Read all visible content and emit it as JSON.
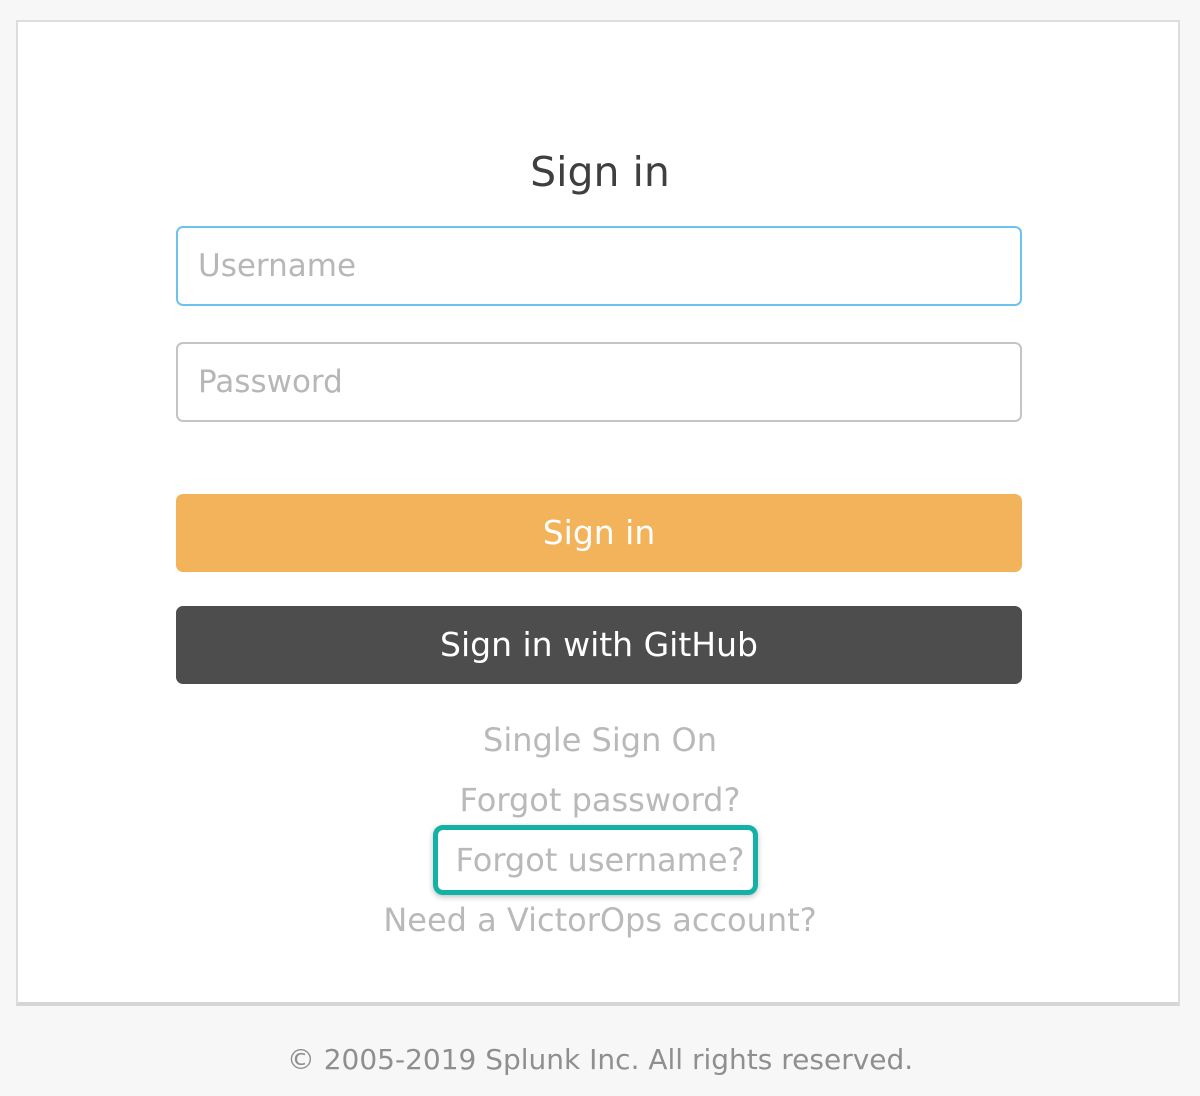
{
  "form": {
    "title": "Sign in",
    "username_placeholder": "Username",
    "password_placeholder": "Password",
    "signin_label": "Sign in",
    "github_label": "Sign in with GitHub"
  },
  "links": {
    "sso": "Single Sign On",
    "forgot_password": "Forgot password?",
    "forgot_username": "Forgot username?",
    "need_account": "Need a VictorOps account?"
  },
  "footer": {
    "copyright": "© 2005-2019 Splunk Inc. All rights reserved."
  },
  "colors": {
    "signin_button": "#f2b35b",
    "github_button": "#4d4d4d",
    "focus_border": "#6ec3ec",
    "highlight": "#14b2a6"
  }
}
